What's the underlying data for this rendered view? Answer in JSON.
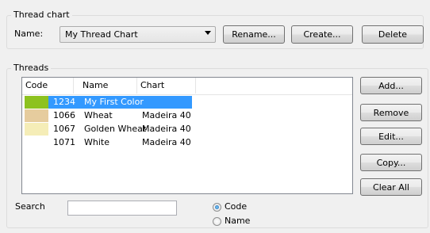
{
  "thread_chart": {
    "group_title": "Thread chart",
    "name_label": "Name:",
    "selected_chart": "My Thread Chart",
    "rename_label": "Rename...",
    "create_label": "Create...",
    "delete_label": "Delete"
  },
  "threads": {
    "group_title": "Threads",
    "columns": [
      "Code",
      "Name",
      "Chart"
    ],
    "rows": [
      {
        "swatch": "#8dc21f",
        "code": "1234",
        "name": "My First Color",
        "chart": "",
        "selected": true
      },
      {
        "swatch": "#e6cc9e",
        "code": "1066",
        "name": "Wheat",
        "chart": "Madeira 40",
        "selected": false
      },
      {
        "swatch": "#f5edb7",
        "code": "1067",
        "name": "Golden Wheat",
        "chart": "Madeira 40",
        "selected": false
      },
      {
        "swatch": "#ffffff",
        "code": "1071",
        "name": "White",
        "chart": "Madeira 40",
        "selected": false
      }
    ],
    "add_label": "Add...",
    "remove_label": "Remove",
    "edit_label": "Edit...",
    "copy_label": "Copy...",
    "clear_all_label": "Clear All"
  },
  "search": {
    "label": "Search",
    "value": "",
    "options": [
      "Code",
      "Name"
    ],
    "selected_option": "Code"
  },
  "colors": {
    "selection": "#3399ff"
  }
}
